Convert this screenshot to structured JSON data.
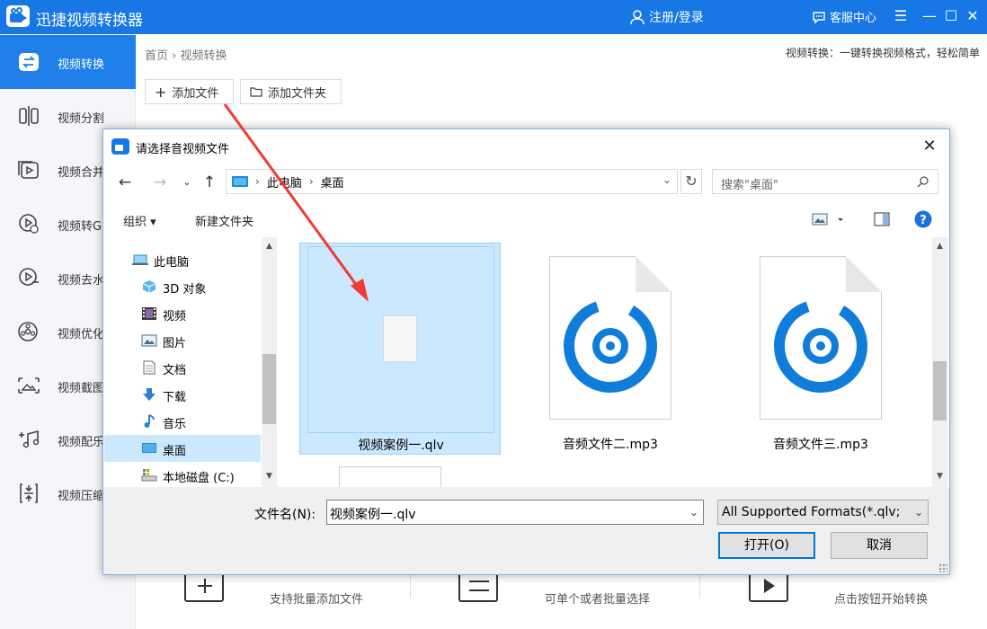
{
  "app": {
    "title": "迅捷视频转换器",
    "login": "注册/登录",
    "service": "客服中心"
  },
  "sidebar": {
    "items": [
      {
        "label": "视频转换",
        "icon": "convert-icon",
        "active": true
      },
      {
        "label": "视频分割",
        "icon": "split-icon"
      },
      {
        "label": "视频合并",
        "icon": "merge-icon"
      },
      {
        "label": "视频转GIF",
        "icon": "gif-icon"
      },
      {
        "label": "视频去水印",
        "icon": "watermark-icon"
      },
      {
        "label": "视频优化",
        "icon": "optimize-icon"
      },
      {
        "label": "视频截图",
        "icon": "screenshot-icon"
      },
      {
        "label": "视频配乐",
        "icon": "music-icon"
      },
      {
        "label": "视频压缩",
        "icon": "compress-icon"
      }
    ]
  },
  "main": {
    "breadcrumb_home": "首页",
    "breadcrumb_sep": "›",
    "breadcrumb_current": "视频转换",
    "tip": "视频转换：一键转换视频格式，轻松简单",
    "add_file": "添加文件",
    "add_folder": "添加文件夹",
    "steps": [
      {
        "text": "支持批量添加文件"
      },
      {
        "text": "可单个或者批量选择"
      },
      {
        "text": "点击按钮开始转换"
      }
    ]
  },
  "dialog": {
    "title": "请选择音视频文件",
    "path": [
      "此电脑",
      "桌面"
    ],
    "search_placeholder": "搜索\"桌面\"",
    "organize": "组织 ▾",
    "new_folder": "新建文件夹",
    "tree": [
      {
        "label": "此电脑",
        "icon": "pc-icon"
      },
      {
        "label": "3D 对象",
        "icon": "cube-icon"
      },
      {
        "label": "视频",
        "icon": "film-icon"
      },
      {
        "label": "图片",
        "icon": "picture-icon"
      },
      {
        "label": "文档",
        "icon": "document-icon"
      },
      {
        "label": "下载",
        "icon": "download-icon"
      },
      {
        "label": "音乐",
        "icon": "music-note-icon"
      },
      {
        "label": "桌面",
        "icon": "desktop-icon",
        "selected": true
      },
      {
        "label": "本地磁盘 (C:)",
        "icon": "disk-icon"
      }
    ],
    "files": [
      {
        "name": "视频案例一.qlv",
        "selected": true
      },
      {
        "name": "音频文件二.mp3"
      },
      {
        "name": "音频文件三.mp3"
      }
    ],
    "filename_label": "文件名(N):",
    "filename_value": "视频案例一.qlv",
    "format": "All Supported Formats(*.qlv;",
    "open": "打开(O)",
    "cancel": "取消",
    "accent": "#0078d7"
  }
}
